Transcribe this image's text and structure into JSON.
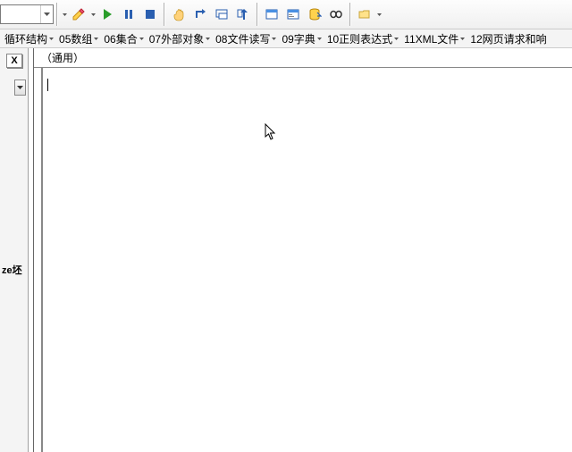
{
  "toolbar": {
    "combo_value": ""
  },
  "menus": [
    "循环结构",
    "05数组",
    "06集合",
    "07外部对象",
    "08文件读写",
    "09字典",
    "10正则表达式",
    "11XML文件",
    "12网页请求和响"
  ],
  "left": {
    "close": "X",
    "ze": "ze坯"
  },
  "editor": {
    "scope": "（通用）",
    "content": ""
  }
}
